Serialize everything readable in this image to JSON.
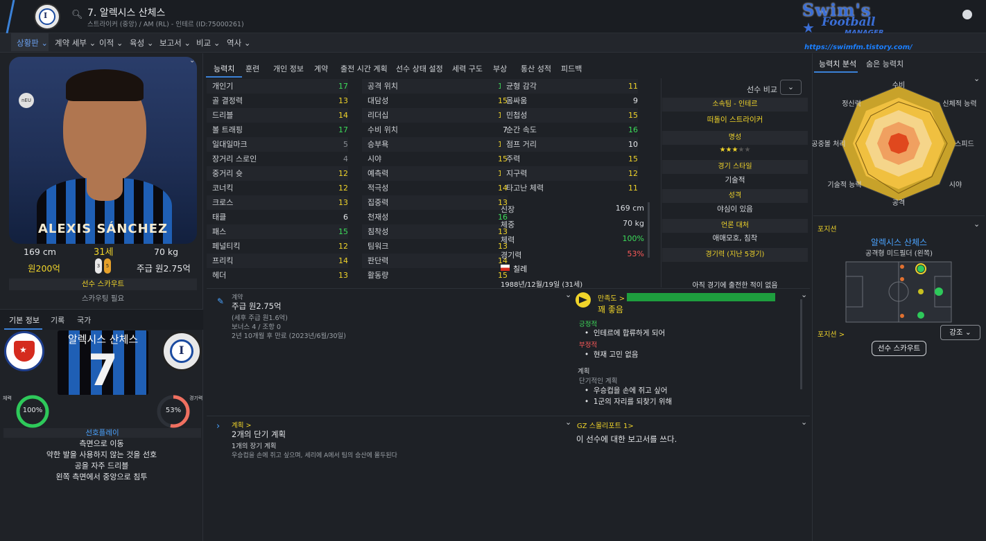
{
  "header": {
    "title": "7. 알렉시스 산체스",
    "subtitle": "스트라이커 (중앙) / AM (RL) - 인테르 (ID:75000261)",
    "watermark_line1": "Swim's",
    "watermark_line2": "Football",
    "watermark_line3": "MANAGER",
    "watermark_url": "https://swimfm.tistory.com/"
  },
  "menu": {
    "items": [
      "상황판",
      "계약 세부",
      "이적",
      "육성",
      "보고서",
      "비교",
      "역사"
    ]
  },
  "profile": {
    "photo_name": "ALEXIS SÁNCHEZ",
    "badge": "nEU",
    "height": "169 cm",
    "age": "31세",
    "weight": "70 kg",
    "value": "원200억",
    "wage": "주급 원2.75억",
    "foot_left": "3",
    "foot_right": "5",
    "scout_title": "선수 스카우트",
    "scout_note": "스카우팅 필요"
  },
  "left_tabs": [
    "기본 정보",
    "기록",
    "국가"
  ],
  "shirt": {
    "name": "알렉시스 산체스",
    "number": "7"
  },
  "rings": {
    "fitness_label": "체력",
    "fitness_value": "100%",
    "fitness_pct": 100,
    "match_label": "경기력",
    "match_value": "53%",
    "match_pct": 53
  },
  "pref": {
    "title": "선호플레이",
    "items": [
      "측면으로 이동",
      "약한 발을 사용하지 않는 것을 선호",
      "공을 자주 드리블",
      "왼쪽 측면에서 중앙으로 침투"
    ]
  },
  "tabs": [
    "능력치",
    "훈련",
    "개인 정보",
    "계약",
    "출전 시간 계획",
    "선수 상태 설정",
    "세력 구도",
    "부상",
    "통산 성적",
    "피드백"
  ],
  "attrs_col1": [
    {
      "name": "개인기",
      "value": "17",
      "color": "g"
    },
    {
      "name": "골 결정력",
      "value": "13",
      "color": "y"
    },
    {
      "name": "드리블",
      "value": "14",
      "color": "y"
    },
    {
      "name": "볼 트래핑",
      "value": "17",
      "color": "g"
    },
    {
      "name": "일대일마크",
      "value": "5",
      "color": "d"
    },
    {
      "name": "장거리 스로인",
      "value": "4",
      "color": "d"
    },
    {
      "name": "중거리 슛",
      "value": "12",
      "color": "y"
    },
    {
      "name": "코너킥",
      "value": "12",
      "color": "y"
    },
    {
      "name": "크로스",
      "value": "13",
      "color": "y"
    },
    {
      "name": "태클",
      "value": "6",
      "color": "w"
    },
    {
      "name": "패스",
      "value": "15",
      "color": "g"
    },
    {
      "name": "페널티킥",
      "value": "12",
      "color": "y"
    },
    {
      "name": "프리킥",
      "value": "14",
      "color": "y"
    },
    {
      "name": "헤더",
      "value": "13",
      "color": "y"
    }
  ],
  "attrs_col2": [
    {
      "name": "공격 위치",
      "value": "16",
      "color": "g"
    },
    {
      "name": "대담성",
      "value": "15",
      "color": "y"
    },
    {
      "name": "리더십",
      "value": "12",
      "color": "y"
    },
    {
      "name": "수비 위치",
      "value": "7",
      "color": "w"
    },
    {
      "name": "승부욕",
      "value": "14",
      "color": "y"
    },
    {
      "name": "시야",
      "value": "15",
      "color": "y"
    },
    {
      "name": "예측력",
      "value": "13",
      "color": "y"
    },
    {
      "name": "적극성",
      "value": "14",
      "color": "y"
    },
    {
      "name": "집중력",
      "value": "13",
      "color": "y"
    },
    {
      "name": "천재성",
      "value": "16",
      "color": "g"
    },
    {
      "name": "침착성",
      "value": "13",
      "color": "y"
    },
    {
      "name": "팀워크",
      "value": "13",
      "color": "y"
    },
    {
      "name": "판단력",
      "value": "14",
      "color": "y"
    },
    {
      "name": "활동량",
      "value": "15",
      "color": "y"
    }
  ],
  "attrs_col3": [
    {
      "name": "균형 감각",
      "value": "11",
      "color": "y"
    },
    {
      "name": "몸싸움",
      "value": "9",
      "color": "w"
    },
    {
      "name": "민첩성",
      "value": "15",
      "color": "y"
    },
    {
      "name": "순간 속도",
      "value": "16",
      "color": "g"
    },
    {
      "name": "점프 거리",
      "value": "10",
      "color": "w"
    },
    {
      "name": "주력",
      "value": "15",
      "color": "y"
    },
    {
      "name": "지구력",
      "value": "12",
      "color": "y"
    },
    {
      "name": "타고난 체력",
      "value": "11",
      "color": "y"
    }
  ],
  "physical": {
    "height_label": "신장",
    "height": "169 cm",
    "weight_label": "체중",
    "weight": "70 kg",
    "fitness_label": "체력",
    "fitness": "100%",
    "match_label": "경기력",
    "match": "53%",
    "nation": "칠레",
    "dob": "1988년/12월/19일 (31세)"
  },
  "info": {
    "compare_label": "선수 비교",
    "club_head": "소속팀 - 인테르",
    "club_role": "떠돌이 스트라이커",
    "rep_head": "명성",
    "rep_stars": "★★★",
    "rep_stars_off": "★★",
    "style_head": "경기 스타일",
    "style": "기술적",
    "personality_head": "성격",
    "personality": "야심이 있음",
    "media_head": "언론 대처",
    "media": "애매모호, 침착",
    "form_head": "경기력 (지난 5경기)",
    "form_note": "아직 경기에 출전한 적이 없음"
  },
  "contract": {
    "label": "계약",
    "wage": "주급 원2.75억",
    "gross": "(세후 주급 원1.6억)",
    "bonus": "보너스 4 / 조항 0",
    "expiry": "2년 10개월 후 만료 (2023년/6월/30일)"
  },
  "happiness": {
    "label": "만족도 >",
    "state": "꽤 좋음",
    "pos_label": "긍정적",
    "pos_item": "인테르에 합류하게 되어",
    "neg_label": "부정적",
    "neg_item": "현재 고민 없음",
    "plan_label": "계획",
    "plan_sub": "단기적인 계획",
    "plan_items": [
      "우승컵을 손에 쥐고 싶어",
      "1군의 자리를 되찾기 위해"
    ]
  },
  "plans": {
    "label": "계획 >",
    "title": "2개의 단기 계획",
    "sub": "1개의 장기 계획",
    "desc": "우승컵을 손에 쥐고 싶으며, 세리에 A에서 팀의 승산에 몰두된다"
  },
  "report": {
    "label": "GZ 스몰리포트 1>",
    "text": "이 선수에 대한 보고서를 쓰다."
  },
  "right_tabs": [
    "능력치 분석",
    "숨은 능력치"
  ],
  "radar": {
    "labels": [
      "수비",
      "신체적 능력",
      "스피드",
      "시야",
      "공격",
      "기술적 능력",
      "공중볼 처리",
      "정신력"
    ]
  },
  "position": {
    "head": "포지션",
    "name": "알렉시스 산체스",
    "role": "공격형 미드필더 (왼쪽)",
    "footer": "포지션 >",
    "emph": "강조",
    "scout_btn": "선수 스카우트"
  }
}
